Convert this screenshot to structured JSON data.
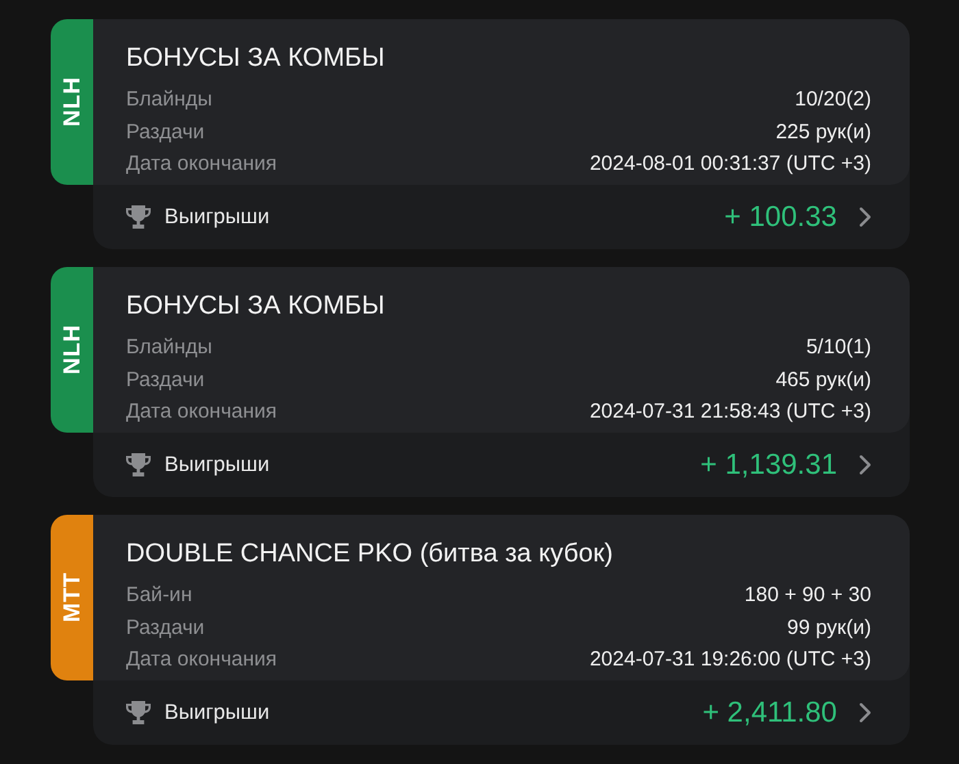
{
  "cards": [
    {
      "tag": "NLH",
      "color": "#1b8f4e",
      "title": "БОНУСЫ ЗА КОМБЫ",
      "details": [
        {
          "label": "Блайнды",
          "value": "10/20(2)"
        },
        {
          "label": "Раздачи",
          "value": "225 рук(и)"
        },
        {
          "label": "Дата окончания",
          "value": "2024-08-01 00:31:37 (UTC +3)"
        }
      ],
      "winnings_label": "Выигрыши",
      "winnings": "+ 100.33"
    },
    {
      "tag": "NLH",
      "color": "#1b8f4e",
      "title": "БОНУСЫ ЗА КОМБЫ",
      "details": [
        {
          "label": "Блайнды",
          "value": "5/10(1)"
        },
        {
          "label": "Раздачи",
          "value": "465 рук(и)"
        },
        {
          "label": "Дата окончания",
          "value": "2024-07-31 21:58:43 (UTC +3)"
        }
      ],
      "winnings_label": "Выигрыши",
      "winnings": "+ 1,139.31"
    },
    {
      "tag": "MTT",
      "color": "#e0820f",
      "title": "DOUBLE CHANCE PKO (битва за кубок)",
      "details": [
        {
          "label": "Бай-ин",
          "value": "180 + 90 + 30"
        },
        {
          "label": "Раздачи",
          "value": "99 рук(и)"
        },
        {
          "label": "Дата окончания",
          "value": "2024-07-31 19:26:00 (UTC +3)"
        }
      ],
      "winnings_label": "Выигрыши",
      "winnings": "+ 2,411.80"
    }
  ]
}
